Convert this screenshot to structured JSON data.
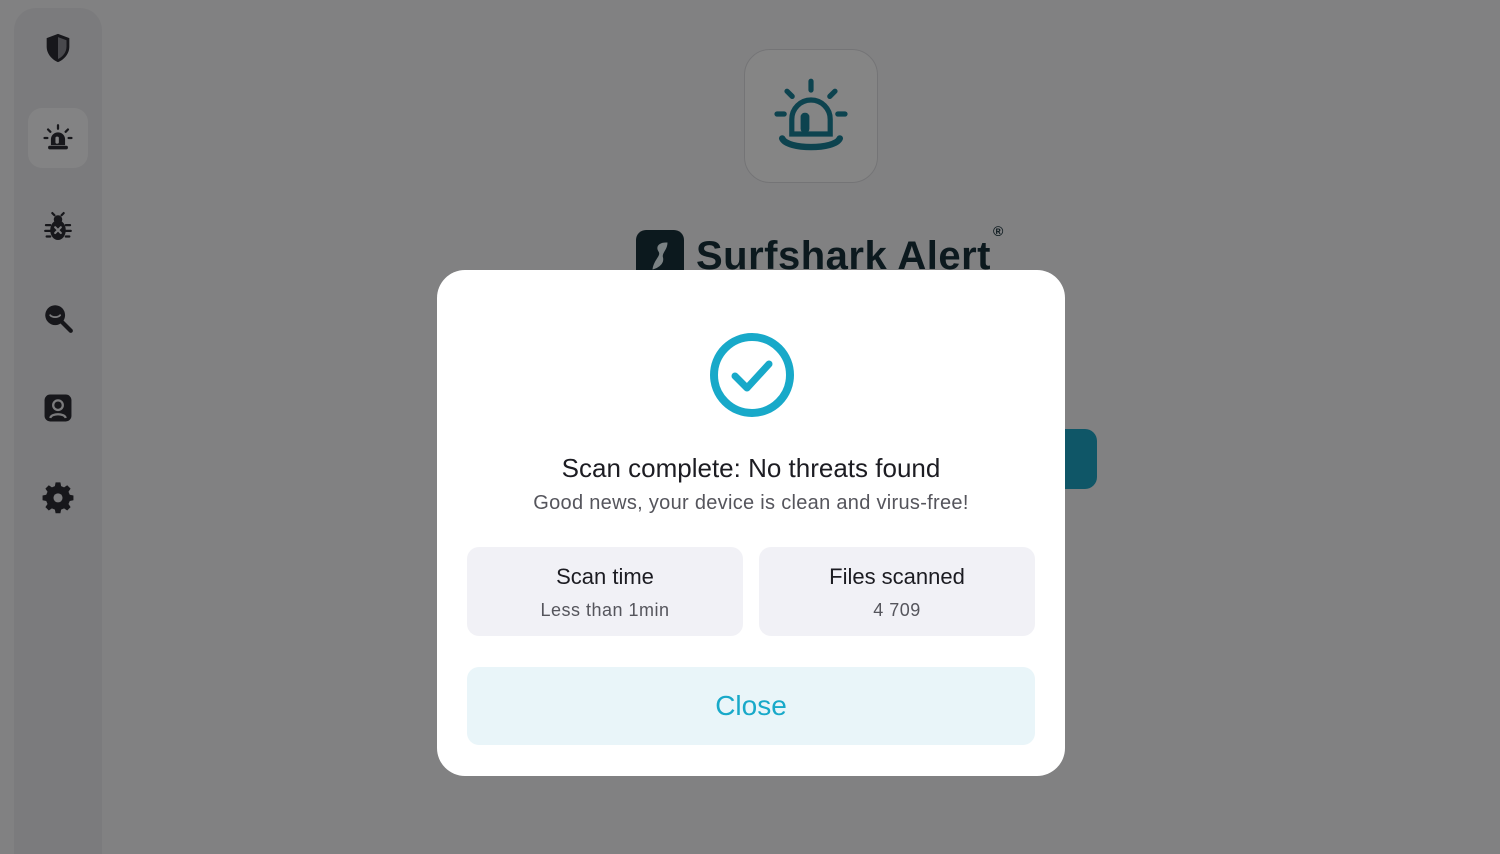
{
  "app": {
    "brand_name": "Surfshark Alert",
    "brand_mark": "®",
    "sidebar": {
      "items": [
        {
          "name": "shield-icon",
          "active": false
        },
        {
          "name": "alarm-icon",
          "active": true
        },
        {
          "name": "bug-icon",
          "active": false
        },
        {
          "name": "search-eye-icon",
          "active": false
        },
        {
          "name": "person-icon",
          "active": false
        },
        {
          "name": "gear-icon",
          "active": false
        }
      ]
    }
  },
  "modal": {
    "title": "Scan complete: No threats found",
    "subtitle": "Good news, your device is clean and virus-free!",
    "stats": [
      {
        "label": "Scan time",
        "value": "Less than 1min"
      },
      {
        "label": "Files scanned",
        "value": "4 709"
      }
    ],
    "close_label": "Close"
  },
  "colors": {
    "accent": "#18a9c9",
    "brand_dark": "#17303a",
    "overlay": "rgba(0,0,0,0.47)"
  }
}
